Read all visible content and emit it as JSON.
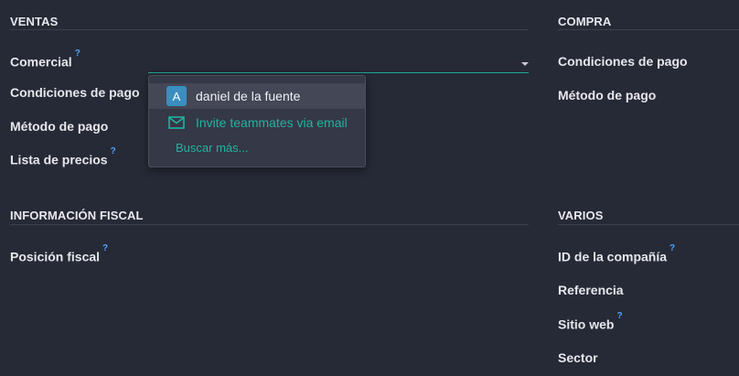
{
  "ventas": {
    "title": "VENTAS",
    "fields": [
      {
        "label": "Comercial",
        "help": "?"
      },
      {
        "label": "Condiciones de pago"
      },
      {
        "label": "Método de pago"
      },
      {
        "label": "Lista de precios",
        "help": "?"
      }
    ]
  },
  "compra": {
    "title": "COMPRA",
    "fields": [
      {
        "label": "Condiciones de pago"
      },
      {
        "label": "Método de pago"
      }
    ]
  },
  "fiscal": {
    "title": "INFORMACIÓN FISCAL",
    "fields": [
      {
        "label": "Posición fiscal",
        "help": "?"
      }
    ]
  },
  "varios": {
    "title": "VARIOS",
    "fields": [
      {
        "label": "ID de la compañía",
        "help": "?"
      },
      {
        "label": "Referencia"
      },
      {
        "label": "Sitio web",
        "help": "?"
      },
      {
        "label": "Sector"
      }
    ]
  },
  "dropdown": {
    "user": {
      "initial": "A",
      "name": "daniel de la fuente"
    },
    "invite_label": "Invite teammates via email",
    "search_more_label": "Buscar más..."
  },
  "colors": {
    "background": "#262a36",
    "accent_teal": "#21b3a0",
    "help_blue": "#4ea3ff",
    "avatar_blue": "#3a8fc0"
  },
  "icons": {
    "invite": "envelope-icon",
    "dropdown_toggle": "caret-down-icon"
  }
}
